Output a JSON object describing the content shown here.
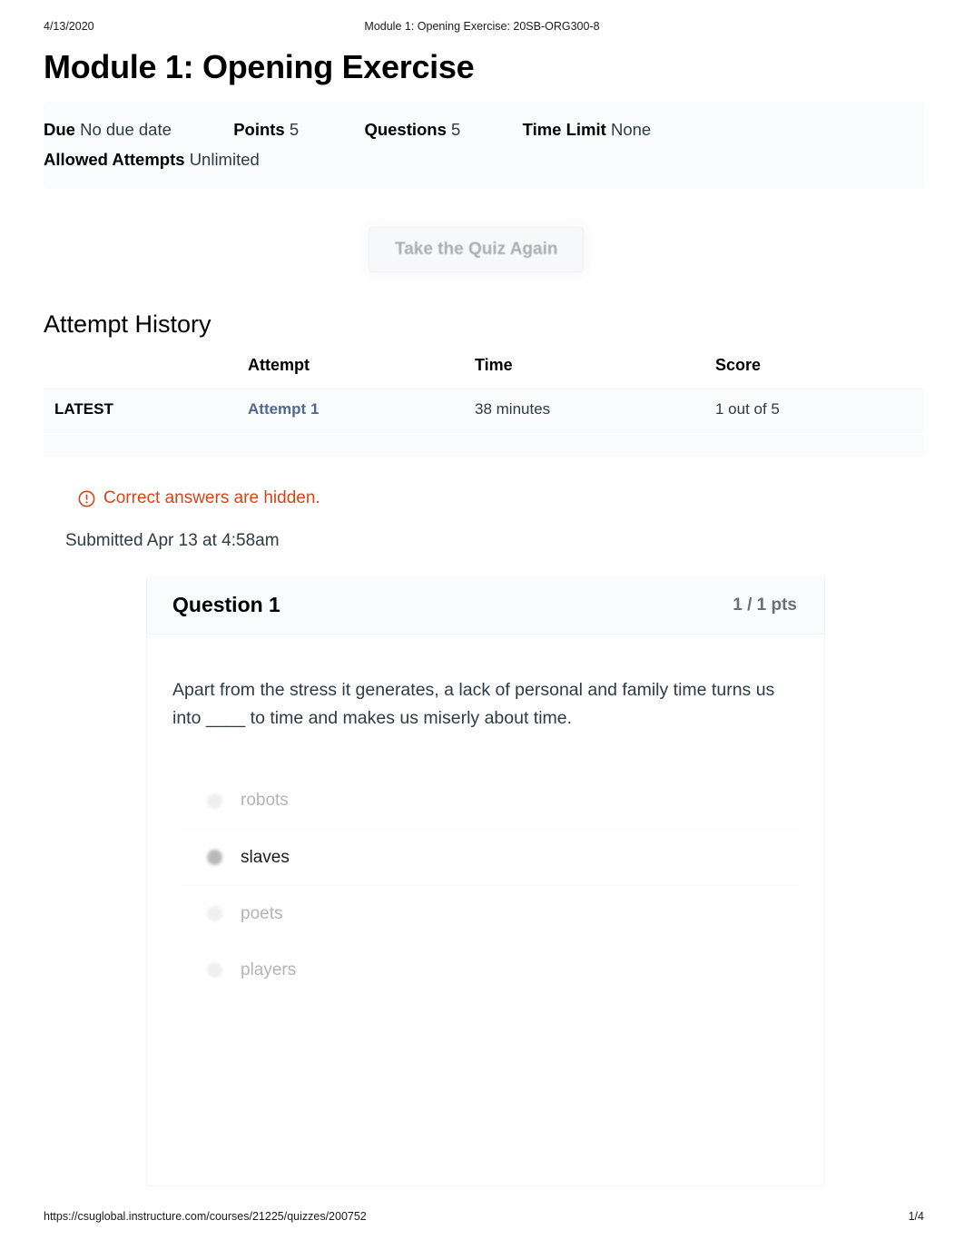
{
  "print_header": {
    "date": "4/13/2020",
    "title": "Module 1: Opening Exercise: 20SB-ORG300-8"
  },
  "page_title": "Module 1: Opening Exercise",
  "quiz_meta": {
    "due_label": "Due",
    "due_value": "No due date",
    "points_label": "Points",
    "points_value": "5",
    "questions_label": "Questions",
    "questions_value": "5",
    "time_limit_label": "Time Limit",
    "time_limit_value": "None",
    "allowed_attempts_label": "Allowed Attempts",
    "allowed_attempts_value": "Unlimited"
  },
  "take_again_button": "Take the Quiz Again",
  "attempt_history": {
    "heading": "Attempt History",
    "columns": [
      "",
      "Attempt",
      "Time",
      "Score"
    ],
    "rows": [
      {
        "latest": "LATEST",
        "attempt": "Attempt 1",
        "time": "38 minutes",
        "score": "1 out of 5"
      }
    ]
  },
  "notice": {
    "icon": "warning-circle-icon",
    "text": "Correct answers are hidden."
  },
  "submitted": "Submitted Apr 13 at 4:58am",
  "question": {
    "title": "Question 1",
    "points": "1 / 1 pts",
    "text": "Apart from the stress it generates, a lack of personal and family time turns us into ____ to time and makes us miserly about time.",
    "answers": [
      {
        "label": "robots",
        "selected": false
      },
      {
        "label": "slaves",
        "selected": true
      },
      {
        "label": "poets",
        "selected": false
      },
      {
        "label": "players",
        "selected": false
      }
    ]
  },
  "print_footer": {
    "url": "https://csuglobal.instructure.com/courses/21225/quizzes/200752",
    "page": "1/4"
  },
  "colors": {
    "notice": "#d5441c",
    "link": "#4d6a8c",
    "muted": "#b2b5b8",
    "band": "#fafbfc"
  }
}
